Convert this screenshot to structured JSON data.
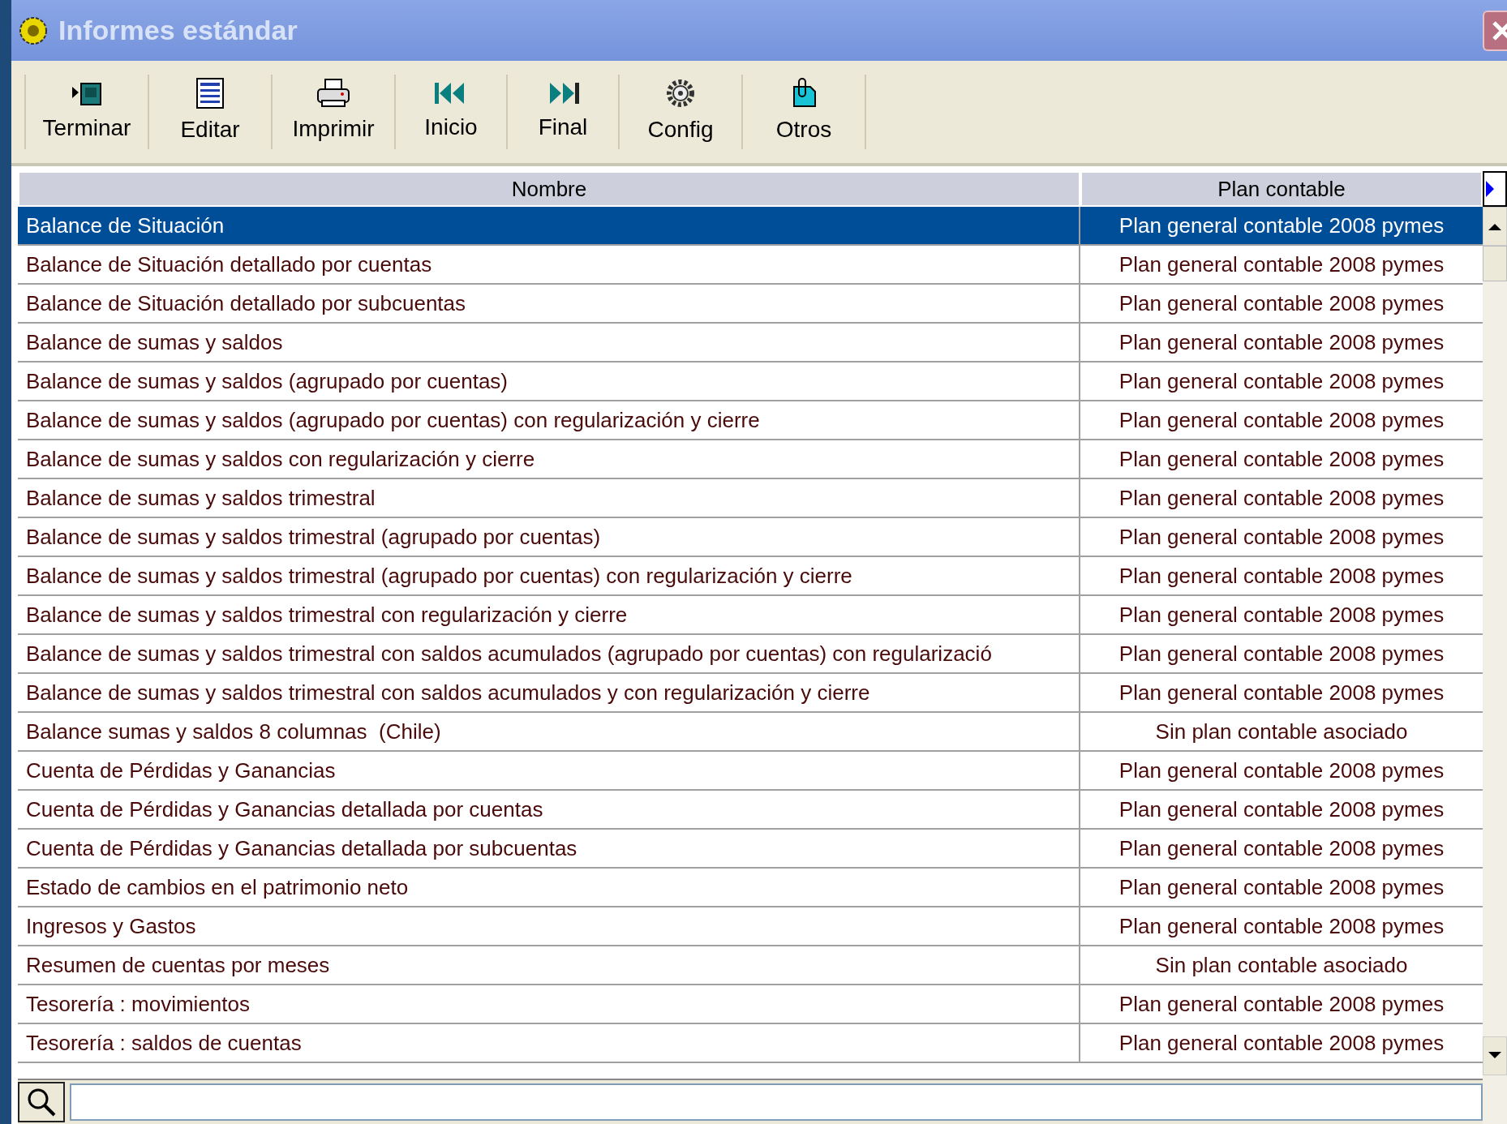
{
  "window": {
    "title": "Informes estándar"
  },
  "toolbar": [
    {
      "label": "Terminar",
      "kind": "exit"
    },
    {
      "label": "Editar",
      "kind": "edit"
    },
    {
      "label": "Imprimir",
      "kind": "print"
    },
    {
      "label": "Inicio",
      "kind": "first"
    },
    {
      "label": "Final",
      "kind": "last"
    },
    {
      "label": "Config",
      "kind": "config"
    },
    {
      "label": "Otros",
      "kind": "other"
    }
  ],
  "table": {
    "columns": [
      "Nombre",
      "Plan contable"
    ],
    "rows": [
      {
        "name": "Balance de Situación",
        "plan": "Plan general contable 2008 pymes",
        "selected": true
      },
      {
        "name": "Balance de Situación detallado por cuentas",
        "plan": "Plan general contable 2008 pymes",
        "selected": false
      },
      {
        "name": "Balance de Situación detallado por subcuentas",
        "plan": "Plan general contable 2008 pymes",
        "selected": false
      },
      {
        "name": "Balance de sumas y saldos",
        "plan": "Plan general contable 2008 pymes",
        "selected": false
      },
      {
        "name": "Balance de sumas y saldos (agrupado por cuentas)",
        "plan": "Plan general contable 2008 pymes",
        "selected": false
      },
      {
        "name": "Balance de sumas y saldos (agrupado por cuentas) con regularización y cierre",
        "plan": "Plan general contable 2008 pymes",
        "selected": false
      },
      {
        "name": "Balance de sumas y saldos con regularización y cierre",
        "plan": "Plan general contable 2008 pymes",
        "selected": false
      },
      {
        "name": "Balance de sumas y saldos trimestral",
        "plan": "Plan general contable 2008 pymes",
        "selected": false
      },
      {
        "name": "Balance de sumas y saldos trimestral (agrupado por cuentas)",
        "plan": "Plan general contable 2008 pymes",
        "selected": false
      },
      {
        "name": "Balance de sumas y saldos trimestral (agrupado por cuentas) con regularización y cierre",
        "plan": "Plan general contable 2008 pymes",
        "selected": false
      },
      {
        "name": "Balance de sumas y saldos trimestral con regularización y cierre",
        "plan": "Plan general contable 2008 pymes",
        "selected": false
      },
      {
        "name": "Balance de sumas y saldos trimestral con saldos acumulados (agrupado por cuentas) con regularizació",
        "plan": "Plan general contable 2008 pymes",
        "selected": false
      },
      {
        "name": "Balance de sumas y saldos trimestral con saldos acumulados y con regularización y cierre",
        "plan": "Plan general contable 2008 pymes",
        "selected": false
      },
      {
        "name": "Balance sumas y saldos 8 columnas  (Chile)",
        "plan": "Sin plan contable asociado",
        "selected": false
      },
      {
        "name": "Cuenta de Pérdidas y Ganancias",
        "plan": "Plan general contable 2008 pymes",
        "selected": false
      },
      {
        "name": "Cuenta de Pérdidas y Ganancias detallada por cuentas",
        "plan": "Plan general contable 2008 pymes",
        "selected": false
      },
      {
        "name": "Cuenta de Pérdidas y Ganancias detallada por subcuentas",
        "plan": "Plan general contable 2008 pymes",
        "selected": false
      },
      {
        "name": "Estado de cambios en el patrimonio neto",
        "plan": "Plan general contable 2008 pymes",
        "selected": false
      },
      {
        "name": "Ingresos y Gastos",
        "plan": "Plan general contable 2008 pymes",
        "selected": false
      },
      {
        "name": "Resumen de cuentas por meses",
        "plan": "Sin plan contable asociado",
        "selected": false
      },
      {
        "name": "Tesorería : movimientos",
        "plan": "Plan general contable 2008 pymes",
        "selected": false
      },
      {
        "name": "Tesorería : saldos de cuentas",
        "plan": "Plan general contable 2008 pymes",
        "selected": false
      }
    ]
  }
}
